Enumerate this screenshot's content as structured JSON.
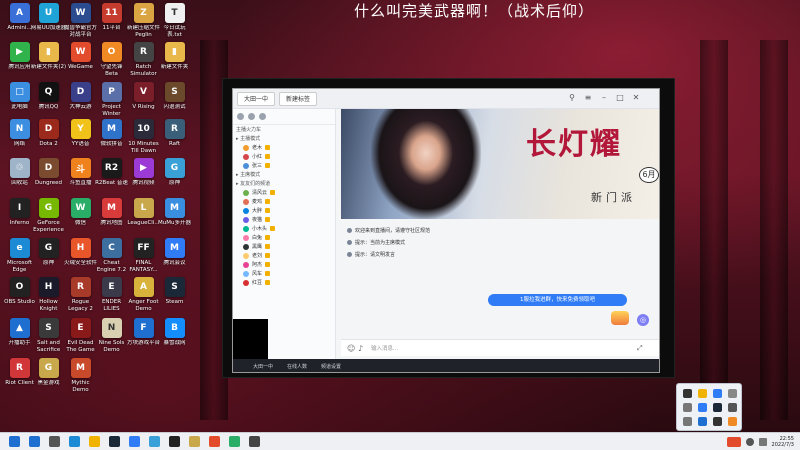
{
  "overlay_title": "什么叫完美武器啊！（战术后仰）",
  "desktop_icons": [
    {
      "label": "Admini...",
      "color": "#3a6fd8",
      "glyph": "A"
    },
    {
      "label": "网易UU加速器",
      "color": "#1fa3d6",
      "glyph": "U"
    },
    {
      "label": "魔兽争霸官方对战平台",
      "color": "#2b4c8f",
      "glyph": "W"
    },
    {
      "label": "11平台",
      "color": "#c53b2e",
      "glyph": "11"
    },
    {
      "label": "新建压缩文件 Peglin",
      "color": "#d9a441",
      "glyph": "Z"
    },
    {
      "label": "今日试玩表.txt",
      "color": "#f0f0f0",
      "glyph": "T"
    },
    {
      "label": "腾讯应用",
      "color": "#2fb34a",
      "glyph": "▶"
    },
    {
      "label": "新建文件夹(2)",
      "color": "#e8b84a",
      "glyph": "▮"
    },
    {
      "label": "WeGame",
      "color": "#e24b2c",
      "glyph": "W"
    },
    {
      "label": "守望先锋 Beta",
      "color": "#f08a24",
      "glyph": "O"
    },
    {
      "label": "Ratch Simulator",
      "color": "#444444",
      "glyph": "R"
    },
    {
      "label": "新建文件夹",
      "color": "#e8b84a",
      "glyph": "▮"
    },
    {
      "label": "此电脑",
      "color": "#3b8ee0",
      "glyph": "□"
    },
    {
      "label": "腾讯QQ",
      "color": "#111111",
      "glyph": "Q"
    },
    {
      "label": "大神云游",
      "color": "#3a3f8a",
      "glyph": "D"
    },
    {
      "label": "Project Winter",
      "color": "#5b6fa8",
      "glyph": "P"
    },
    {
      "label": "V Rising",
      "color": "#7a1f2a",
      "glyph": "V"
    },
    {
      "label": "闪退测试",
      "color": "#6a4a2a",
      "glyph": "S"
    },
    {
      "label": "网络",
      "color": "#3b8ee0",
      "glyph": "N"
    },
    {
      "label": "Dota 2",
      "color": "#9c2a1c",
      "glyph": "D"
    },
    {
      "label": "YY语音",
      "color": "#f0c21a",
      "glyph": "Y"
    },
    {
      "label": "微软拼音",
      "color": "#2e73c9",
      "glyph": "M"
    },
    {
      "label": "10 Minutes Till Dawn",
      "color": "#2a2a3a",
      "glyph": "10"
    },
    {
      "label": "Raft",
      "color": "#3a5f78",
      "glyph": "R"
    },
    {
      "label": "回收站",
      "color": "#9fb4c8",
      "glyph": "♲"
    },
    {
      "label": "Dungreed",
      "color": "#7a4b2e",
      "glyph": "D"
    },
    {
      "label": "斗鱼直播",
      "color": "#f0821e",
      "glyph": "斗"
    },
    {
      "label": "R2Beat 音速",
      "color": "#1a1a1a",
      "glyph": "R2"
    },
    {
      "label": "腾讯视频",
      "color": "#9c3ad6",
      "glyph": "▶"
    },
    {
      "label": "原神",
      "color": "#3aa0d8",
      "glyph": "G"
    },
    {
      "label": "Inferno",
      "color": "#222222",
      "glyph": "I"
    },
    {
      "label": "GeForce Experience",
      "color": "#76b900",
      "glyph": "G"
    },
    {
      "label": "微信",
      "color": "#2aae67",
      "glyph": "W"
    },
    {
      "label": "腾讯地图",
      "color": "#d93a3a",
      "glyph": "M"
    },
    {
      "label": "LeagueCli...",
      "color": "#c8a84a",
      "glyph": "L"
    },
    {
      "label": "MuMu多开器",
      "color": "#3a8ee0",
      "glyph": "M"
    },
    {
      "label": "Microsoft Edge",
      "color": "#1c8ad4",
      "glyph": "e"
    },
    {
      "label": "原神",
      "color": "#222222",
      "glyph": "G"
    },
    {
      "label": "火绒安全软件",
      "color": "#e8562a",
      "glyph": "H"
    },
    {
      "label": "Cheat Engine 7.2",
      "color": "#3c6fa0",
      "glyph": "C"
    },
    {
      "label": "FINAL FANTASY...",
      "color": "#222222",
      "glyph": "FF"
    },
    {
      "label": "腾讯会议",
      "color": "#2f7cf6",
      "glyph": "M"
    },
    {
      "label": "OBS Studio",
      "color": "#222222",
      "glyph": "O"
    },
    {
      "label": "Hollow Knight",
      "color": "#1a1a2a",
      "glyph": "H"
    },
    {
      "label": "Rogue Legacy 2",
      "color": "#a83a2a",
      "glyph": "R"
    },
    {
      "label": "ENDER LILIES",
      "color": "#3a3a4a",
      "glyph": "E"
    },
    {
      "label": "Anger Foot Demo",
      "color": "#d8b23a",
      "glyph": "A"
    },
    {
      "label": "Steam",
      "color": "#1b2838",
      "glyph": "S"
    },
    {
      "label": "开播助手",
      "color": "#1f6fd0",
      "glyph": "▲"
    },
    {
      "label": "Salt and Sacrifice",
      "color": "#3a3a3a",
      "glyph": "S"
    },
    {
      "label": "Evil Dead The Game",
      "color": "#8a1a1a",
      "glyph": "E"
    },
    {
      "label": "Nine Sols Demo",
      "color": "#d8d0b0",
      "glyph": "N"
    },
    {
      "label": "方块游戏平台",
      "color": "#1f6fd0",
      "glyph": "F"
    },
    {
      "label": "暴雪战网",
      "color": "#148eff",
      "glyph": "B"
    },
    {
      "label": "Riot Client",
      "color": "#d13639",
      "glyph": "R"
    },
    {
      "label": "黑金游戏",
      "color": "#c8a84a",
      "glyph": "G"
    },
    {
      "label": "Mythic Demo",
      "color": "#c84a2a",
      "glyph": "M"
    }
  ],
  "qq_window": {
    "tab1": "大田一中",
    "tab2": "新建标签",
    "panel_header": "主播火力车",
    "sections": [
      {
        "label": "主播模式",
        "type": "section"
      },
      {
        "label": "老木",
        "type": "member",
        "color": "#f29b2e"
      },
      {
        "label": "小红",
        "type": "member",
        "color": "#d6474a"
      },
      {
        "label": "张三",
        "type": "member",
        "color": "#4a90d9"
      },
      {
        "label": "主席模式",
        "type": "section"
      },
      {
        "label": "友友们的频道",
        "type": "section"
      },
      {
        "label": "清风云",
        "type": "member",
        "color": "#6ab04c"
      },
      {
        "label": "麦鸡",
        "type": "member",
        "color": "#e17055"
      },
      {
        "label": "大胖",
        "type": "member",
        "color": "#0984e3"
      },
      {
        "label": "夜猫",
        "type": "member",
        "color": "#6c5ce7"
      },
      {
        "label": "小木头",
        "type": "member",
        "color": "#00b894"
      },
      {
        "label": "白兔",
        "type": "member",
        "color": "#fd79a8"
      },
      {
        "label": "黑鹰",
        "type": "member",
        "color": "#2d3436"
      },
      {
        "label": "老刘",
        "type": "member",
        "color": "#fdcb6e"
      },
      {
        "label": "阿杰",
        "type": "member",
        "color": "#e84393"
      },
      {
        "label": "风车",
        "type": "member",
        "color": "#74b9ff"
      },
      {
        "label": "红豆",
        "type": "member",
        "color": "#d63031"
      }
    ],
    "banner_title": "长灯耀",
    "banner_date": "6月",
    "banner_sub": "新门派",
    "notices": [
      "欢迎来到直播间，请遵守社区规范",
      "提示：当前为主席模式",
      "提示：请文明发言"
    ],
    "bubble_text": "1服拉我进群，快来免费领取吧",
    "input_placeholder": "输入消息...",
    "status_items": [
      "大田一中",
      "在线人数",
      "频道设置"
    ]
  },
  "clock": {
    "time": "22:55",
    "date": "2022/7/3"
  },
  "taskbar_icons": [
    "#1f6fd0",
    "#555555",
    "#1c8ad4",
    "#f0b400",
    "#1b2838",
    "#2f7cf6",
    "#3aa0d8",
    "#222222",
    "#c8a84a",
    "#e24b2c",
    "#2aae67",
    "#444444"
  ],
  "tray_icons": [
    "#333333",
    "#f0b400",
    "#2f7cf6",
    "#888888",
    "#777777",
    "#2f7cf6",
    "#1b2838",
    "#555555",
    "#777777",
    "#1f6fd0",
    "#333333",
    "#f08a24"
  ]
}
